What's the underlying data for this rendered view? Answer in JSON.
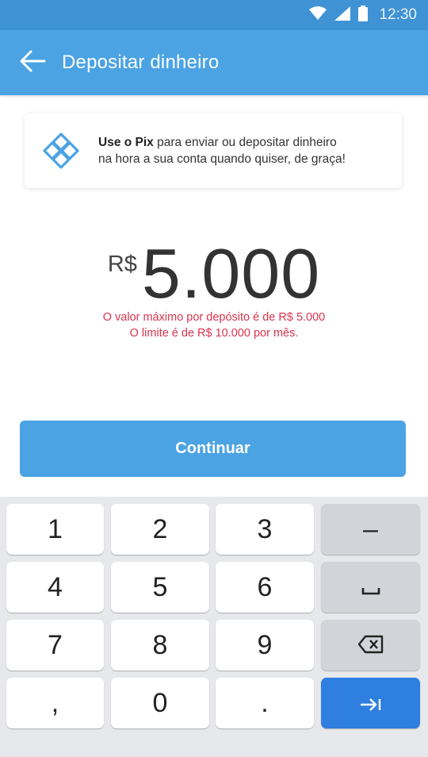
{
  "status_bar": {
    "time": "12:30",
    "icons": [
      "wifi-icon",
      "signal-icon",
      "battery-icon"
    ]
  },
  "app_bar": {
    "title": "Depositar dinheiro",
    "back_icon": "arrow-left-icon"
  },
  "info_card": {
    "icon": "pix-icon",
    "bold_text": "Use o Pix",
    "text_line1_rest": " para enviar ou depositar dinheiro",
    "text_line2": "na hora a sua conta quando quiser, de graça!"
  },
  "amount": {
    "currency": "R$",
    "value": "5.000",
    "limit_line1": "O valor máximo por depósito é de R$ 5.000",
    "limit_line2": "O limite é de R$ 10.000 por mês."
  },
  "continue_label": "Continuar",
  "keyboard": {
    "keys": {
      "k1": "1",
      "k2": "2",
      "k3": "3",
      "minus": "–",
      "k4": "4",
      "k5": "5",
      "k6": "6",
      "k7": "7",
      "k8": "8",
      "k9": "9",
      "comma": ",",
      "k0": "0",
      "period": "."
    },
    "special_icons": [
      "space-icon",
      "backspace-icon",
      "next-tab-icon"
    ]
  },
  "colors": {
    "status_bar": "#3f93d4",
    "app_bar": "#4ba3e3",
    "button": "#4ba3e3",
    "error_text": "#d9334d",
    "keyboard_bg": "#e7e8eb",
    "action_key": "#2f7fe0"
  }
}
